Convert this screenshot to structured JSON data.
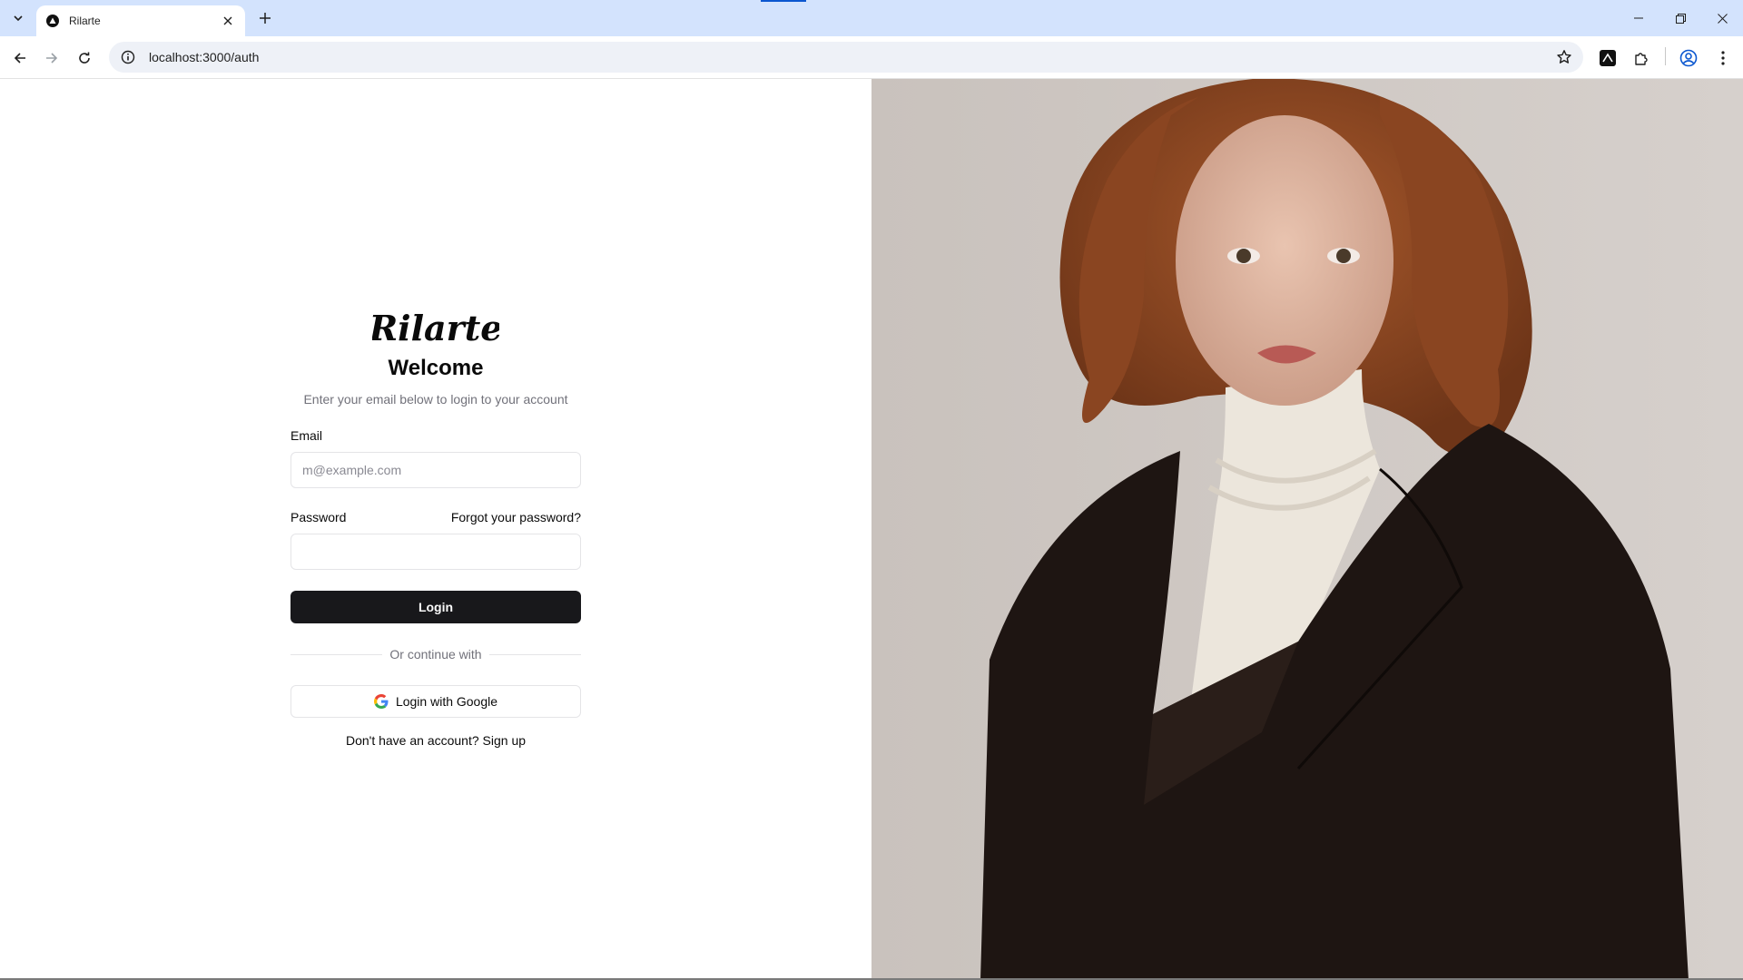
{
  "browser": {
    "tab_title": "Rilarte",
    "url": "localhost:3000/auth"
  },
  "auth": {
    "brand": "Rilarte",
    "title": "Welcome",
    "subtitle": "Enter your email below to login to your account",
    "email_label": "Email",
    "email_placeholder": "m@example.com",
    "email_value": "",
    "password_label": "Password",
    "password_value": "",
    "forgot_password": "Forgot your password?",
    "login_button": "Login",
    "divider_text": "Or continue with",
    "google_button": "Login with Google",
    "signup_prompt": "Don't have an account?",
    "signup_link": "Sign up"
  },
  "colors": {
    "primary": "#18181b",
    "muted_text": "#71717a",
    "border": "#e4e4e7",
    "tabstrip": "#d3e3fd"
  }
}
